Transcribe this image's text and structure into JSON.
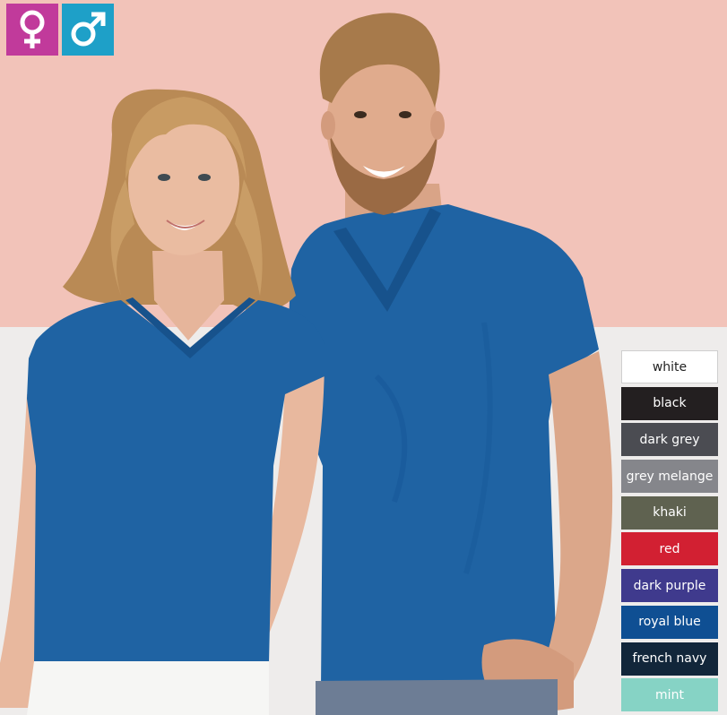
{
  "gender_filter": {
    "female": {
      "icon": "female-symbol-icon",
      "color": "#c13a9b"
    },
    "male": {
      "icon": "male-symbol-icon",
      "color": "#1ea0c8"
    }
  },
  "photo": {
    "subject": "woman and man wearing royal blue v-neck t-shirts",
    "shirt_color": "#1f63a3"
  },
  "color_swatches": [
    {
      "label": "white",
      "color": "#ffffff",
      "text_color": "#222222"
    },
    {
      "label": "black",
      "color": "#231f20",
      "text_color": "#ffffff"
    },
    {
      "label": "dark grey",
      "color": "#4b4c52",
      "text_color": "#ffffff"
    },
    {
      "label": "grey melange",
      "color": "#85868b",
      "text_color": "#ffffff"
    },
    {
      "label": "khaki",
      "color": "#5f6250",
      "text_color": "#ffffff"
    },
    {
      "label": "red",
      "color": "#d22032",
      "text_color": "#ffffff"
    },
    {
      "label": "dark purple",
      "color": "#3f3a8d",
      "text_color": "#ffffff"
    },
    {
      "label": "royal blue",
      "color": "#0f4f93",
      "text_color": "#ffffff"
    },
    {
      "label": "french navy",
      "color": "#12263a",
      "text_color": "#ffffff"
    },
    {
      "label": "mint",
      "color": "#86d3c5",
      "text_color": "#ffffff"
    }
  ]
}
